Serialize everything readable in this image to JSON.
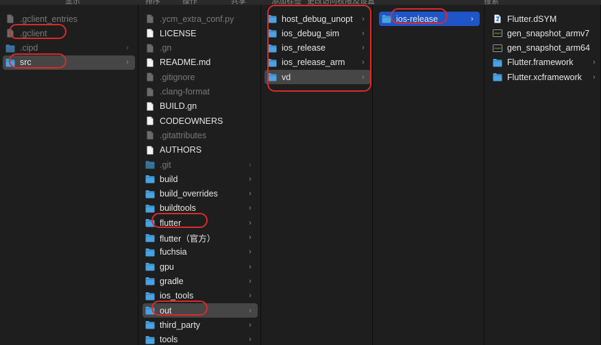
{
  "toolbar": {
    "labels": [
      "显示",
      "排序",
      "操作",
      "共享",
      "添加标签",
      "更改访问权限及设置",
      "搜索"
    ]
  },
  "columns": [
    {
      "items": [
        {
          "label": ".gclient_entries",
          "icon": "file-icon",
          "dim": true,
          "folder": false
        },
        {
          "label": ".gclient",
          "icon": "file-icon",
          "dim": true,
          "folder": false
        },
        {
          "label": ".cipd",
          "icon": "folder-icon",
          "dim": true,
          "folder": true
        },
        {
          "label": "src",
          "icon": "folder-icon",
          "dim": false,
          "folder": true,
          "selected": "gray"
        }
      ]
    },
    {
      "items": [
        {
          "label": ".ycm_extra_conf.py",
          "icon": "file-icon",
          "dim": true,
          "folder": false
        },
        {
          "label": "LICENSE",
          "icon": "file-icon",
          "dim": false,
          "folder": false
        },
        {
          "label": ".gn",
          "icon": "file-icon",
          "dim": true,
          "folder": false
        },
        {
          "label": "README.md",
          "icon": "file-icon",
          "dim": false,
          "folder": false
        },
        {
          "label": ".gitignore",
          "icon": "file-icon",
          "dim": true,
          "folder": false
        },
        {
          "label": ".clang-format",
          "icon": "file-icon",
          "dim": true,
          "folder": false
        },
        {
          "label": "BUILD.gn",
          "icon": "file-icon",
          "dim": false,
          "folder": false
        },
        {
          "label": "CODEOWNERS",
          "icon": "file-icon",
          "dim": false,
          "folder": false
        },
        {
          "label": ".gitattributes",
          "icon": "file-icon",
          "dim": true,
          "folder": false
        },
        {
          "label": "AUTHORS",
          "icon": "file-icon",
          "dim": false,
          "folder": false
        },
        {
          "label": ".git",
          "icon": "folder-icon",
          "dim": true,
          "folder": true
        },
        {
          "label": "build",
          "icon": "folder-icon",
          "dim": false,
          "folder": true
        },
        {
          "label": "build_overrides",
          "icon": "folder-icon",
          "dim": false,
          "folder": true
        },
        {
          "label": "buildtools",
          "icon": "folder-icon",
          "dim": false,
          "folder": true
        },
        {
          "label": "flutter",
          "icon": "folder-icon",
          "dim": false,
          "folder": true
        },
        {
          "label": "flutter（官方）",
          "icon": "folder-icon",
          "dim": false,
          "folder": true
        },
        {
          "label": "fuchsia",
          "icon": "folder-icon",
          "dim": false,
          "folder": true
        },
        {
          "label": "gpu",
          "icon": "folder-icon",
          "dim": false,
          "folder": true
        },
        {
          "label": "gradle",
          "icon": "folder-icon",
          "dim": false,
          "folder": true
        },
        {
          "label": "ios_tools",
          "icon": "folder-icon",
          "dim": false,
          "folder": true
        },
        {
          "label": "out",
          "icon": "folder-icon",
          "dim": false,
          "folder": true,
          "selected": "gray"
        },
        {
          "label": "third_party",
          "icon": "folder-icon",
          "dim": false,
          "folder": true
        },
        {
          "label": "tools",
          "icon": "folder-icon",
          "dim": false,
          "folder": true
        }
      ]
    },
    {
      "items": [
        {
          "label": "host_debug_unopt",
          "icon": "folder-icon",
          "dim": false,
          "folder": true
        },
        {
          "label": "ios_debug_sim",
          "icon": "folder-icon",
          "dim": false,
          "folder": true
        },
        {
          "label": "ios_release",
          "icon": "folder-icon",
          "dim": false,
          "folder": true
        },
        {
          "label": "ios_release_arm",
          "icon": "folder-icon",
          "dim": false,
          "folder": true
        },
        {
          "label": "vd",
          "icon": "folder-icon",
          "dim": false,
          "folder": true,
          "selected": "gray"
        }
      ]
    },
    {
      "items": [
        {
          "label": "ios-release",
          "icon": "folder-icon",
          "dim": false,
          "folder": true,
          "selected": "blue"
        }
      ]
    },
    {
      "items": [
        {
          "label": "Flutter.dSYM",
          "icon": "dsym-file-icon",
          "dim": false,
          "folder": false
        },
        {
          "label": "gen_snapshot_armv7",
          "icon": "executable-icon",
          "dim": false,
          "folder": false
        },
        {
          "label": "gen_snapshot_arm64",
          "icon": "executable-icon",
          "dim": false,
          "folder": false
        },
        {
          "label": "Flutter.framework",
          "icon": "folder-icon",
          "dim": false,
          "folder": true
        },
        {
          "label": "Flutter.xcframework",
          "icon": "folder-icon",
          "dim": false,
          "folder": true
        }
      ]
    }
  ],
  "colors": {
    "background": "#1e1e1e",
    "folder": "#4aa3e0",
    "selection_gray": "#464646",
    "selection_blue": "#1f55c6",
    "annotation_red": "#d92b2b"
  }
}
